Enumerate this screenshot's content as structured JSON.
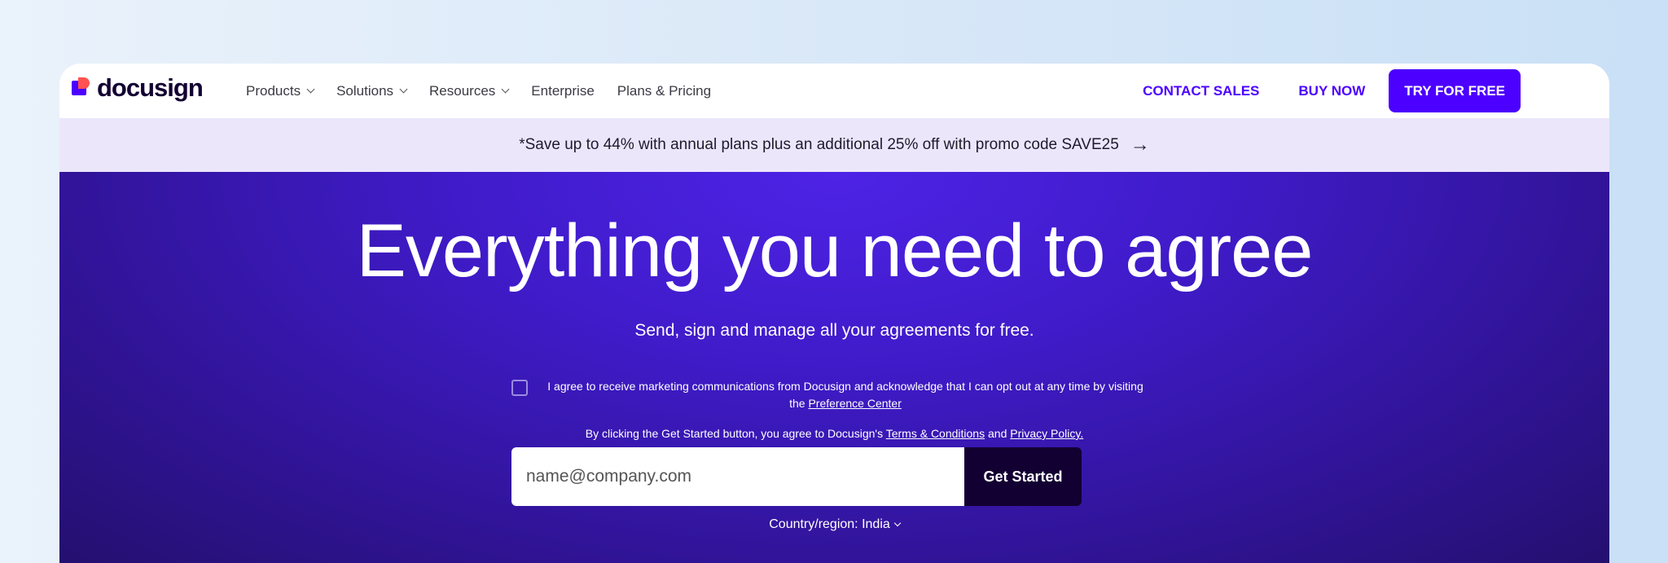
{
  "brand": {
    "name": "docusign"
  },
  "nav": {
    "links": [
      {
        "label": "Products",
        "has_menu": true
      },
      {
        "label": "Solutions",
        "has_menu": true
      },
      {
        "label": "Resources",
        "has_menu": true
      },
      {
        "label": "Enterprise",
        "has_menu": false
      },
      {
        "label": "Plans & Pricing",
        "has_menu": false
      }
    ],
    "contact_sales": "CONTACT SALES",
    "buy_now": "BUY NOW",
    "try_free": "TRY FOR FREE"
  },
  "promo": {
    "text": "*Save up to 44% with annual plans plus an additional 25% off with promo code SAVE25",
    "arrow_icon": "arrow-right-icon"
  },
  "hero": {
    "title": "Everything you need to agree",
    "subtitle": "Send, sign and manage all your agreements for free.",
    "consent_pre": "I agree to receive marketing communications from Docusign and acknowledge that I can opt out at any time by visiting the ",
    "consent_link": "Preference Center",
    "terms_pre": "By clicking the Get Started button, you agree to Docusign's ",
    "terms_link": "Terms & Conditions",
    "terms_mid": " and ",
    "privacy_link": "Privacy Policy.",
    "email_placeholder": "name@company.com",
    "email_value": "",
    "cta": "Get Started",
    "country": "Country/region: India"
  },
  "colors": {
    "accent": "#4c00ff",
    "dark": "#130032",
    "promo_bg": "#ece6fb",
    "hero_bg": "#3f1bc9"
  }
}
